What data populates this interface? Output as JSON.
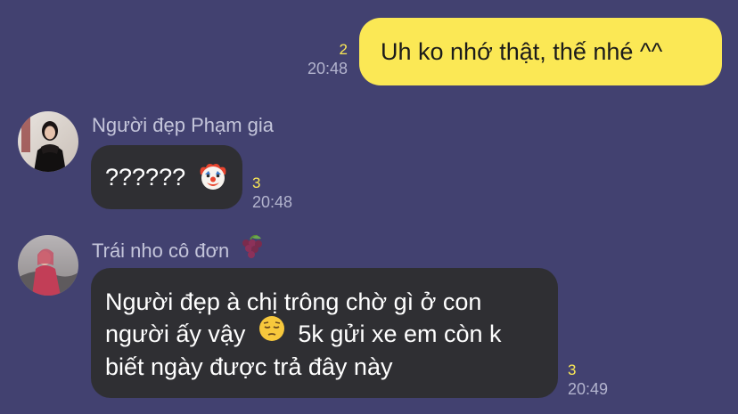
{
  "messages": {
    "outgoing": {
      "text": "Uh ko nhớ thật, thế nhé ^^",
      "read_count": "2",
      "time": "20:48"
    },
    "incoming_1": {
      "sender": "Người đẹp Phạm gia",
      "text": "??????",
      "emoji_icon": "clown-face-icon",
      "read_count": "3",
      "time": "20:48"
    },
    "incoming_2": {
      "sender": "Trái nho cô đơn",
      "sender_emoji_icon": "grapes-icon",
      "line1": "Người đẹp à chị trông chờ gì ở con",
      "line2_part1": "người ấy vậy",
      "line2_emoji_icon": "pensive-face-icon",
      "line2_part2": "5k gửi xe em còn k",
      "line3": "biết ngày được trả đây này",
      "read_count": "3",
      "time": "20:49"
    }
  },
  "colors": {
    "background": "#424170",
    "outgoing_bubble": "#FBE855",
    "incoming_bubble": "#2F2F33",
    "read_count": "#FBE855",
    "timestamp": "#B3B4CE",
    "sender_name": "#C4C5DA"
  }
}
